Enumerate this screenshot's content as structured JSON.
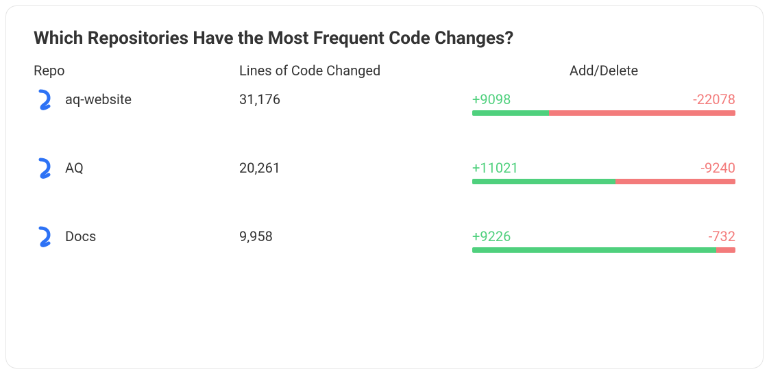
{
  "title": "Which Repositories Have the Most Frequent Code Changes?",
  "headers": {
    "repo": "Repo",
    "lines": "Lines of Code Changed",
    "ad": "Add/Delete"
  },
  "rows": [
    {
      "name": "aq-website",
      "lines": "31,176",
      "add": "+9098",
      "del": "-22078",
      "add_pct": 29.2
    },
    {
      "name": "AQ",
      "lines": "20,261",
      "add": "+11021",
      "del": "-9240",
      "add_pct": 54.4
    },
    {
      "name": "Docs",
      "lines": "9,958",
      "add": "+9226",
      "del": "-732",
      "add_pct": 92.6
    }
  ],
  "chart_data": {
    "type": "table",
    "title": "Which Repositories Have the Most Frequent Code Changes?",
    "columns": [
      "Repo",
      "Lines of Code Changed",
      "Additions",
      "Deletions"
    ],
    "rows": [
      [
        "aq-website",
        31176,
        9098,
        22078
      ],
      [
        "AQ",
        20261,
        11021,
        9240
      ],
      [
        "Docs",
        9958,
        9226,
        732
      ]
    ]
  }
}
